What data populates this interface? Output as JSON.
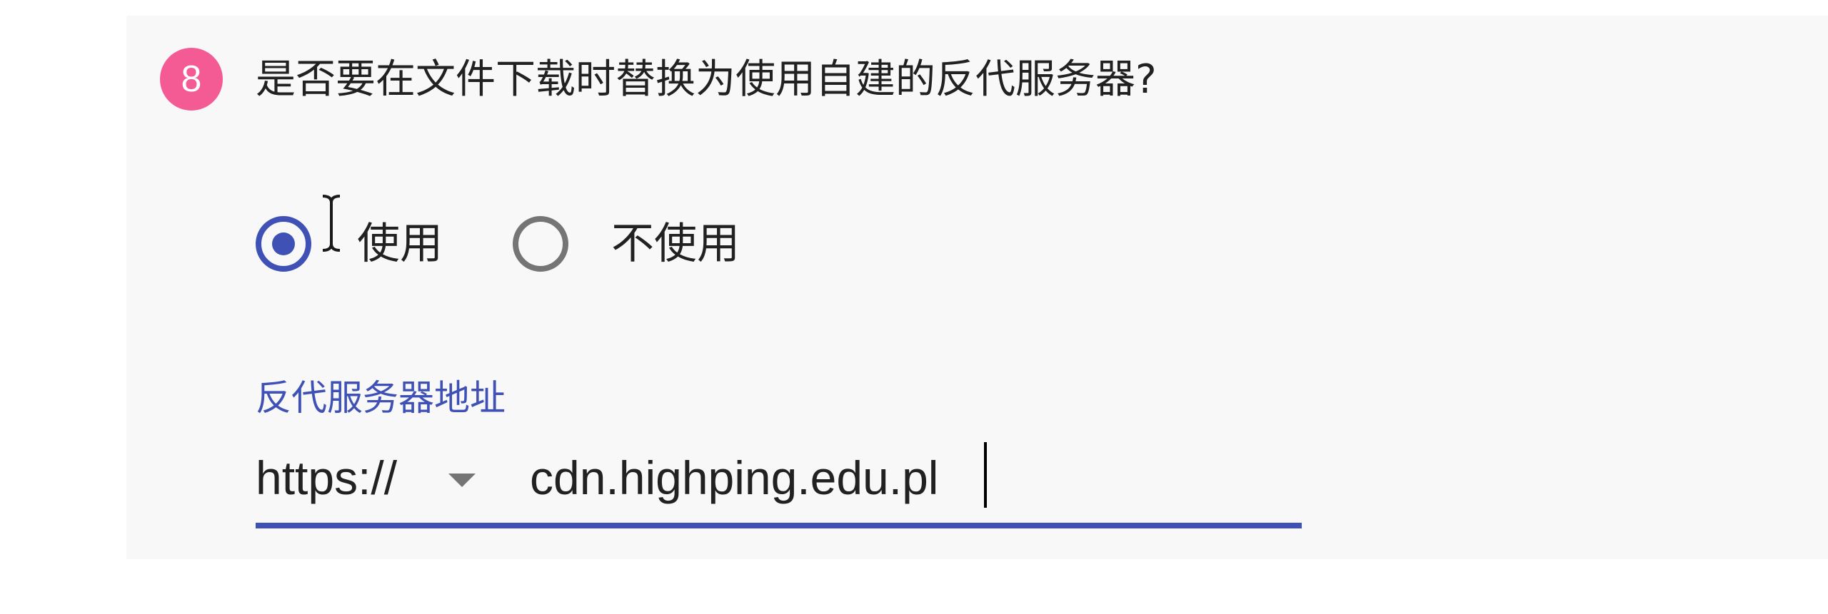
{
  "question": {
    "step_number": "8",
    "text": "是否要在文件下载时替换为使用自建的反代服务器?"
  },
  "radio_group": {
    "options": [
      {
        "label": "使用",
        "checked": true
      },
      {
        "label": "不使用",
        "checked": false
      }
    ]
  },
  "address_field": {
    "label": "反代服务器地址",
    "protocol": "https://",
    "value": "cdn.highping.edu.pl"
  },
  "colors": {
    "accent": "#3f51b5",
    "badge": "#f45b94",
    "card_background": "#f8f8f8"
  },
  "icons": {
    "dropdown": "caret-down-icon",
    "cursor": "text-cursor-icon"
  }
}
